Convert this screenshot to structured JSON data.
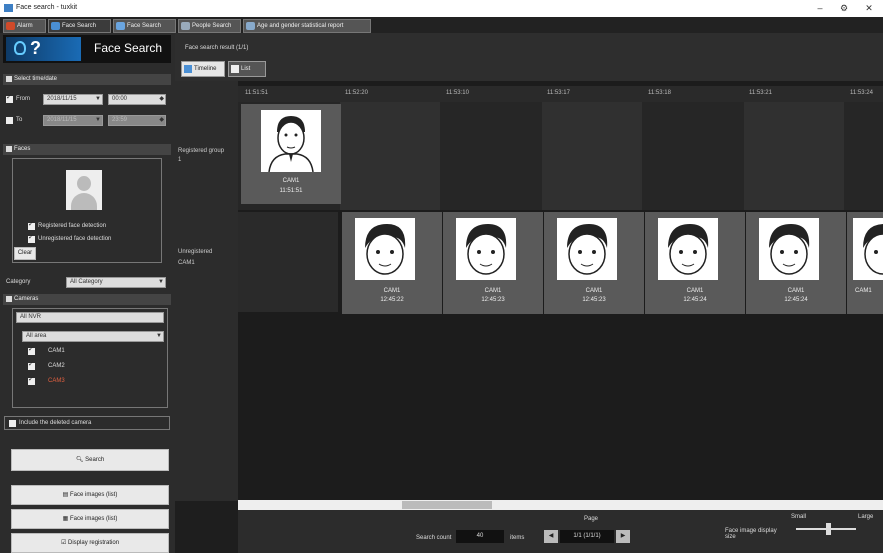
{
  "window": {
    "title": "Face search - tuxkit",
    "minimize": "–",
    "restore": "⚙",
    "close": "✕"
  },
  "tabs": [
    {
      "label": "Alarm",
      "icon": "alarm-icon",
      "color": "#d04a2a"
    },
    {
      "label": "Face Search",
      "icon": "face-search-icon",
      "color": "#4a8fd4"
    },
    {
      "label": "Face Search",
      "icon": "face-search-icon",
      "color": "#6aa5e0"
    },
    {
      "label": "People Search",
      "icon": "people-search-icon",
      "color": "#9ab"
    },
    {
      "label": "Age and gender statistical report",
      "icon": "report-icon",
      "color": "#8ac"
    }
  ],
  "sidebar": {
    "brand_title": "Face Search",
    "brand_logo_text": "?",
    "date_section": {
      "header": "Select time/date",
      "from_label": "From",
      "from_date": "2018/11/15",
      "from_time": "00:00",
      "to_label": "To",
      "to_date": "2018/11/15",
      "to_time": "23:59"
    },
    "faces_section": {
      "header": "Faces",
      "registered_label": "Registered face detection",
      "unregistered_label": "Unregistered face detection",
      "clear_button": "Clear"
    },
    "category": {
      "label": "Category",
      "value": "All Category"
    },
    "cameras_section": {
      "header": "Cameras",
      "server": "All NVR",
      "area": "All area",
      "items": [
        "CAM1",
        "CAM2",
        "CAM3"
      ]
    },
    "include_deleted_label": "Include the deleted camera",
    "search_button": "Search",
    "buttons": [
      {
        "label": "Face images (list)",
        "icon": "face-list-icon"
      },
      {
        "label": "Face images (list)",
        "icon": "face-grid-icon"
      },
      {
        "label": "Display registration",
        "icon": "registration-icon"
      }
    ]
  },
  "main": {
    "header_text": "Face search result (1/1)",
    "tabs": [
      {
        "label": "Timeline",
        "icon": "timeline-icon"
      },
      {
        "label": "List",
        "icon": "list-icon"
      }
    ],
    "columns": [
      "11:51:51",
      "11:52:20",
      "11:53:10",
      "11:53:17",
      "11:53:18",
      "11:53:21",
      "11:53:24"
    ],
    "rows": [
      {
        "label": "Registered group",
        "sublabel": "1",
        "cards": [
          {
            "col": 0,
            "camera": "CAM1",
            "time": "11:51:51",
            "type": "registered"
          }
        ]
      },
      {
        "label": "Unregistered",
        "sublabel": "CAM1",
        "cards": [
          {
            "col": 1,
            "camera": "CAM1",
            "time": "12:45:22",
            "type": "cartoon"
          },
          {
            "col": 2,
            "camera": "CAM1",
            "time": "12:45:23",
            "type": "cartoon"
          },
          {
            "col": 3,
            "camera": "CAM1",
            "time": "12:45:23",
            "type": "cartoon"
          },
          {
            "col": 4,
            "camera": "CAM1",
            "time": "12:45:24",
            "type": "cartoon"
          },
          {
            "col": 5,
            "camera": "CAM1",
            "time": "12:45:24",
            "type": "cartoon"
          },
          {
            "col": 6,
            "camera": "CAM1",
            "time": "",
            "type": "cartoon"
          }
        ]
      }
    ]
  },
  "bottom": {
    "count_label": "Search count",
    "count_value": "40",
    "count_unit": "items",
    "page_label": "Page",
    "page_value": "1/1 (1/1/1)",
    "face_size_label": "Face image display size",
    "small_label": "Small",
    "large_label": "Large",
    "slider_value": 0.55
  }
}
